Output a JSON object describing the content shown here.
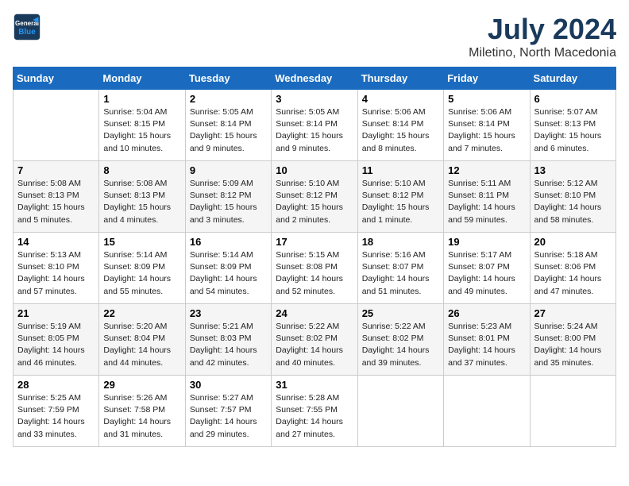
{
  "header": {
    "logo_line1": "General",
    "logo_line2": "Blue",
    "title": "July 2024",
    "subtitle": "Miletino, North Macedonia"
  },
  "columns": [
    "Sunday",
    "Monday",
    "Tuesday",
    "Wednesday",
    "Thursday",
    "Friday",
    "Saturday"
  ],
  "weeks": [
    [
      {
        "day": "",
        "info": ""
      },
      {
        "day": "1",
        "info": "Sunrise: 5:04 AM\nSunset: 8:15 PM\nDaylight: 15 hours\nand 10 minutes."
      },
      {
        "day": "2",
        "info": "Sunrise: 5:05 AM\nSunset: 8:14 PM\nDaylight: 15 hours\nand 9 minutes."
      },
      {
        "day": "3",
        "info": "Sunrise: 5:05 AM\nSunset: 8:14 PM\nDaylight: 15 hours\nand 9 minutes."
      },
      {
        "day": "4",
        "info": "Sunrise: 5:06 AM\nSunset: 8:14 PM\nDaylight: 15 hours\nand 8 minutes."
      },
      {
        "day": "5",
        "info": "Sunrise: 5:06 AM\nSunset: 8:14 PM\nDaylight: 15 hours\nand 7 minutes."
      },
      {
        "day": "6",
        "info": "Sunrise: 5:07 AM\nSunset: 8:13 PM\nDaylight: 15 hours\nand 6 minutes."
      }
    ],
    [
      {
        "day": "7",
        "info": "Sunrise: 5:08 AM\nSunset: 8:13 PM\nDaylight: 15 hours\nand 5 minutes."
      },
      {
        "day": "8",
        "info": "Sunrise: 5:08 AM\nSunset: 8:13 PM\nDaylight: 15 hours\nand 4 minutes."
      },
      {
        "day": "9",
        "info": "Sunrise: 5:09 AM\nSunset: 8:12 PM\nDaylight: 15 hours\nand 3 minutes."
      },
      {
        "day": "10",
        "info": "Sunrise: 5:10 AM\nSunset: 8:12 PM\nDaylight: 15 hours\nand 2 minutes."
      },
      {
        "day": "11",
        "info": "Sunrise: 5:10 AM\nSunset: 8:12 PM\nDaylight: 15 hours\nand 1 minute."
      },
      {
        "day": "12",
        "info": "Sunrise: 5:11 AM\nSunset: 8:11 PM\nDaylight: 14 hours\nand 59 minutes."
      },
      {
        "day": "13",
        "info": "Sunrise: 5:12 AM\nSunset: 8:10 PM\nDaylight: 14 hours\nand 58 minutes."
      }
    ],
    [
      {
        "day": "14",
        "info": "Sunrise: 5:13 AM\nSunset: 8:10 PM\nDaylight: 14 hours\nand 57 minutes."
      },
      {
        "day": "15",
        "info": "Sunrise: 5:14 AM\nSunset: 8:09 PM\nDaylight: 14 hours\nand 55 minutes."
      },
      {
        "day": "16",
        "info": "Sunrise: 5:14 AM\nSunset: 8:09 PM\nDaylight: 14 hours\nand 54 minutes."
      },
      {
        "day": "17",
        "info": "Sunrise: 5:15 AM\nSunset: 8:08 PM\nDaylight: 14 hours\nand 52 minutes."
      },
      {
        "day": "18",
        "info": "Sunrise: 5:16 AM\nSunset: 8:07 PM\nDaylight: 14 hours\nand 51 minutes."
      },
      {
        "day": "19",
        "info": "Sunrise: 5:17 AM\nSunset: 8:07 PM\nDaylight: 14 hours\nand 49 minutes."
      },
      {
        "day": "20",
        "info": "Sunrise: 5:18 AM\nSunset: 8:06 PM\nDaylight: 14 hours\nand 47 minutes."
      }
    ],
    [
      {
        "day": "21",
        "info": "Sunrise: 5:19 AM\nSunset: 8:05 PM\nDaylight: 14 hours\nand 46 minutes."
      },
      {
        "day": "22",
        "info": "Sunrise: 5:20 AM\nSunset: 8:04 PM\nDaylight: 14 hours\nand 44 minutes."
      },
      {
        "day": "23",
        "info": "Sunrise: 5:21 AM\nSunset: 8:03 PM\nDaylight: 14 hours\nand 42 minutes."
      },
      {
        "day": "24",
        "info": "Sunrise: 5:22 AM\nSunset: 8:02 PM\nDaylight: 14 hours\nand 40 minutes."
      },
      {
        "day": "25",
        "info": "Sunrise: 5:22 AM\nSunset: 8:02 PM\nDaylight: 14 hours\nand 39 minutes."
      },
      {
        "day": "26",
        "info": "Sunrise: 5:23 AM\nSunset: 8:01 PM\nDaylight: 14 hours\nand 37 minutes."
      },
      {
        "day": "27",
        "info": "Sunrise: 5:24 AM\nSunset: 8:00 PM\nDaylight: 14 hours\nand 35 minutes."
      }
    ],
    [
      {
        "day": "28",
        "info": "Sunrise: 5:25 AM\nSunset: 7:59 PM\nDaylight: 14 hours\nand 33 minutes."
      },
      {
        "day": "29",
        "info": "Sunrise: 5:26 AM\nSunset: 7:58 PM\nDaylight: 14 hours\nand 31 minutes."
      },
      {
        "day": "30",
        "info": "Sunrise: 5:27 AM\nSunset: 7:57 PM\nDaylight: 14 hours\nand 29 minutes."
      },
      {
        "day": "31",
        "info": "Sunrise: 5:28 AM\nSunset: 7:55 PM\nDaylight: 14 hours\nand 27 minutes."
      },
      {
        "day": "",
        "info": ""
      },
      {
        "day": "",
        "info": ""
      },
      {
        "day": "",
        "info": ""
      }
    ]
  ]
}
